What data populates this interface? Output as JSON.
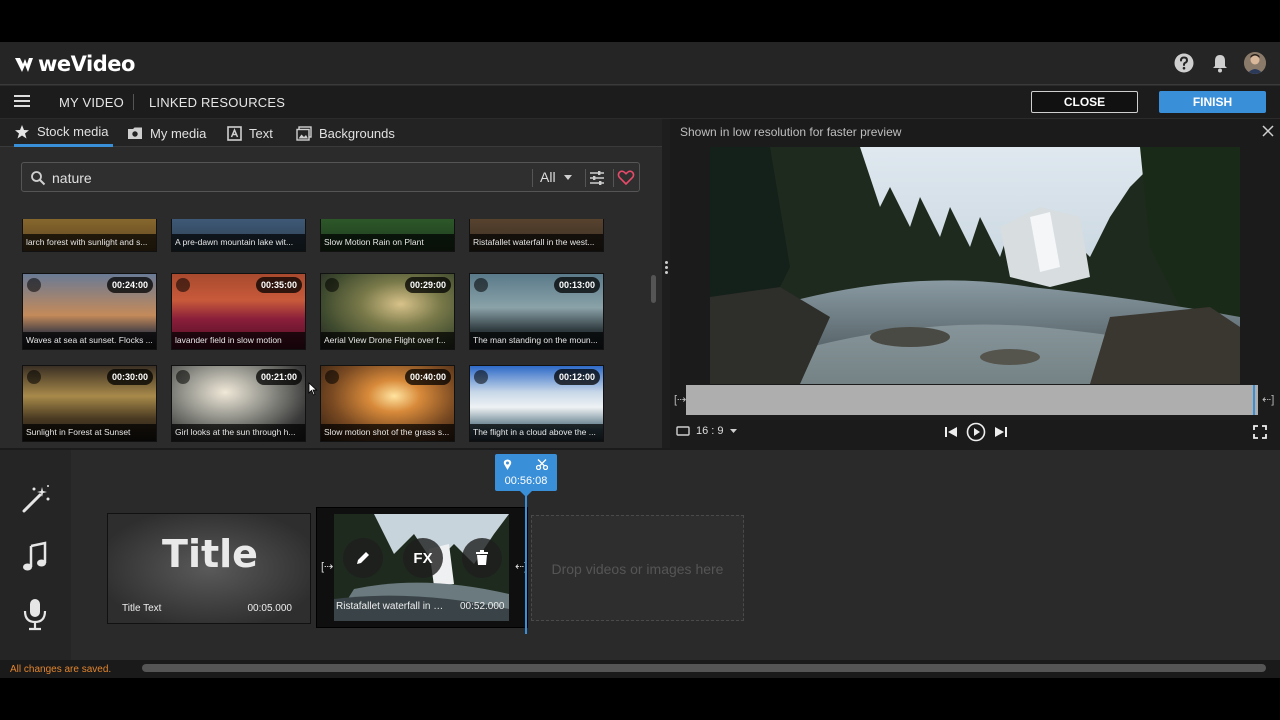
{
  "app": {
    "brand": "weVideo"
  },
  "nav": {
    "my_video": "MY VIDEO",
    "linked_resources": "LINKED RESOURCES",
    "close": "CLOSE",
    "finish": "FINISH"
  },
  "media_tabs": [
    {
      "label": "Stock media",
      "icon": "star-icon",
      "active": true
    },
    {
      "label": "My media",
      "icon": "camera-folder-icon",
      "active": false
    },
    {
      "label": "Text",
      "icon": "text-icon",
      "active": false
    },
    {
      "label": "Backgrounds",
      "icon": "image-icon",
      "active": false
    }
  ],
  "search": {
    "value": "nature",
    "filter": "All"
  },
  "thumbnails_top_row": [
    {
      "caption": "larch forest with sunlight and s..."
    },
    {
      "caption": "A pre-dawn mountain lake wit..."
    },
    {
      "caption": "Slow Motion Rain on Plant"
    },
    {
      "caption": "Ristafallet waterfall in the west..."
    }
  ],
  "thumbnails": [
    {
      "caption": "Waves at sea at sunset. Flocks ...",
      "duration": "00:24:00"
    },
    {
      "caption": "lavander field in slow motion",
      "duration": "00:35:00"
    },
    {
      "caption": "Aerial View Drone Flight over f...",
      "duration": "00:29:00"
    },
    {
      "caption": "The man standing on the moun...",
      "duration": "00:13:00"
    },
    {
      "caption": "Sunlight in Forest at Sunset",
      "duration": "00:30:00"
    },
    {
      "caption": "Girl looks at the sun through h...",
      "duration": "00:21:00"
    },
    {
      "caption": "Slow motion shot of the grass s...",
      "duration": "00:40:00"
    },
    {
      "caption": "The flight in a cloud above the ...",
      "duration": "00:12:00"
    }
  ],
  "preview": {
    "note": "Shown in low resolution for faster preview",
    "aspect": "16 : 9"
  },
  "timeline": {
    "playhead_time": "00:56:08",
    "title_clip": {
      "big": "Title",
      "label": "Title Text",
      "duration": "00:05.000"
    },
    "video_clip": {
      "label": "Ristafallet waterfall in t...",
      "duration": "00:52.000",
      "fx": "FX"
    },
    "dropzone": "Drop videos or images here"
  },
  "status": {
    "saved": "All changes are saved."
  },
  "colors": {
    "accent": "#3a8fd9",
    "saved": "#e2852e",
    "heart": "#e84a6a"
  }
}
